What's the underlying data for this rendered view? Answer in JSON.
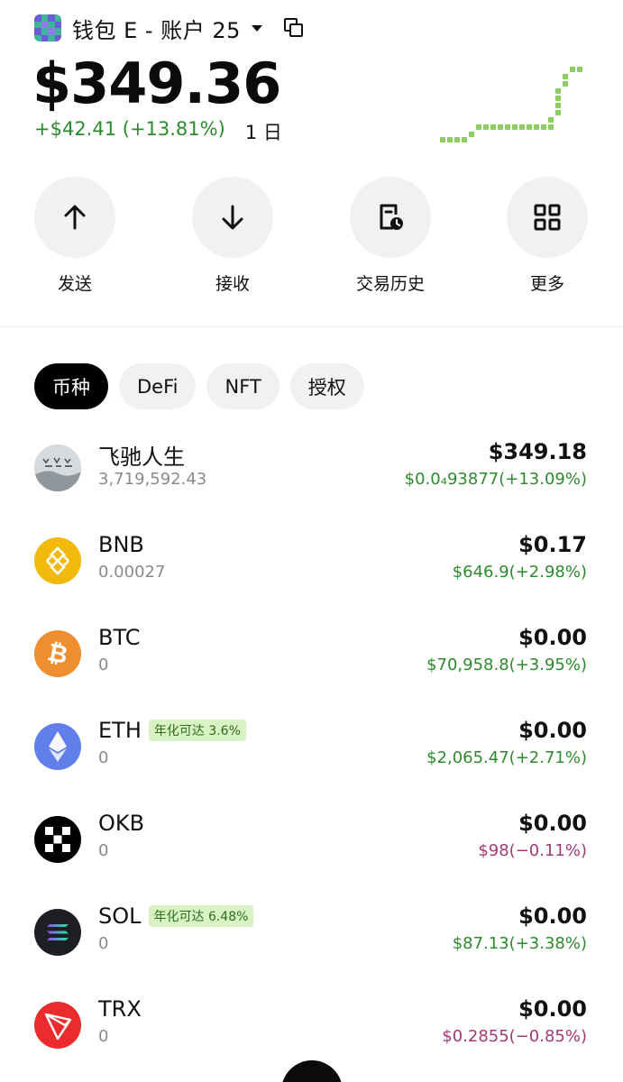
{
  "header": {
    "wallet_name": "钱包 E - 账户 25",
    "balance": "$349.36",
    "change": "+$42.41 (+13.81%)",
    "period": "1 日"
  },
  "actions": [
    {
      "label": "发送",
      "icon": "arrow-up-icon"
    },
    {
      "label": "接收",
      "icon": "arrow-down-icon"
    },
    {
      "label": "交易历史",
      "icon": "history-icon"
    },
    {
      "label": "更多",
      "icon": "grid-icon"
    }
  ],
  "tabs": [
    {
      "label": "币种",
      "active": true
    },
    {
      "label": "DeFi",
      "active": false
    },
    {
      "label": "NFT",
      "active": false
    },
    {
      "label": "授权",
      "active": false
    }
  ],
  "tokens": [
    {
      "symbol": "飞驰人生",
      "amount": "3,719,592.43",
      "usd": "$349.18",
      "price": "$0.0₄93877(+13.09%)",
      "trend": "up",
      "apy": "",
      "icon": "feichi-token-icon"
    },
    {
      "symbol": "BNB",
      "amount": "0.00027",
      "usd": "$0.17",
      "price": "$646.9(+2.98%)",
      "trend": "up",
      "apy": "",
      "icon": "bnb-icon"
    },
    {
      "symbol": "BTC",
      "amount": "0",
      "usd": "$0.00",
      "price": "$70,958.8(+3.95%)",
      "trend": "up",
      "apy": "",
      "icon": "btc-icon"
    },
    {
      "symbol": "ETH",
      "amount": "0",
      "usd": "$0.00",
      "price": "$2,065.47(+2.71%)",
      "trend": "up",
      "apy": "年化可达 3.6%",
      "icon": "eth-icon"
    },
    {
      "symbol": "OKB",
      "amount": "0",
      "usd": "$0.00",
      "price": "$98(−0.11%)",
      "trend": "down",
      "apy": "",
      "icon": "okb-icon"
    },
    {
      "symbol": "SOL",
      "amount": "0",
      "usd": "$0.00",
      "price": "$87.13(+3.38%)",
      "trend": "up",
      "apy": "年化可达 6.48%",
      "icon": "sol-icon"
    },
    {
      "symbol": "TRX",
      "amount": "0",
      "usd": "$0.00",
      "price": "$0.2855(−0.85%)",
      "trend": "down",
      "apy": "",
      "icon": "trx-icon"
    }
  ],
  "colors": {
    "up": "#2e8a2e",
    "down": "#a23a79",
    "sparkline": "#8bcf63",
    "tab_active": "#000000"
  }
}
